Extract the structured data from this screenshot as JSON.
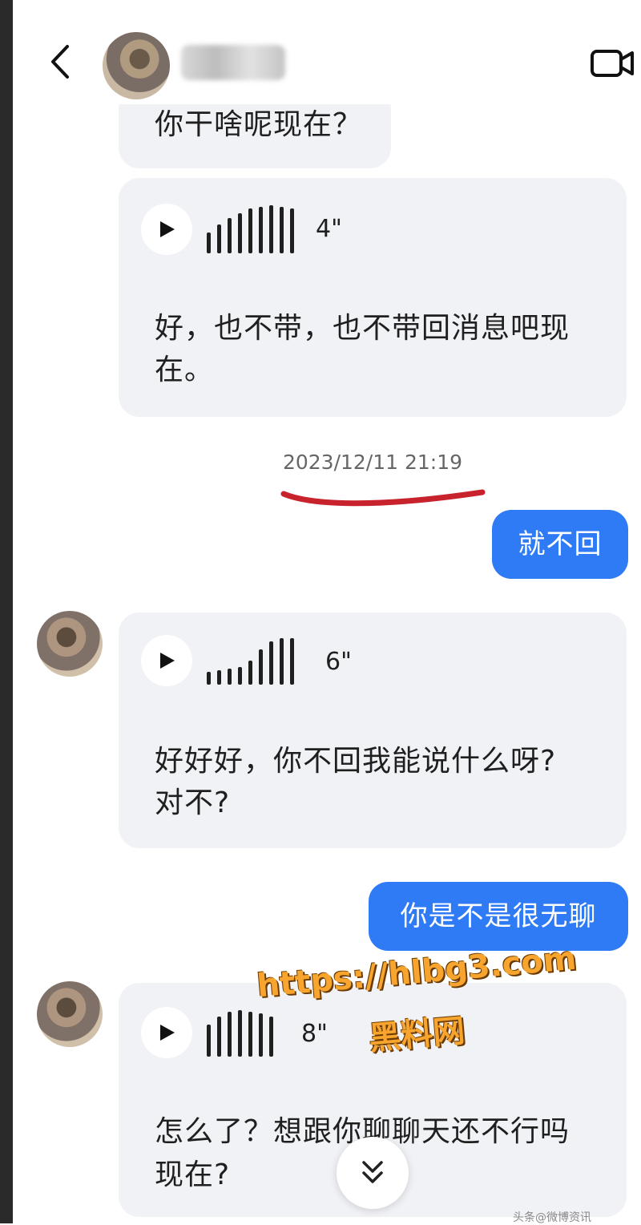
{
  "header": {
    "back_icon": "chevron-left-icon",
    "contact_name": "",
    "video_call_icon": "video-camera-icon"
  },
  "messages": {
    "m1_text": "你干啥呢现在？",
    "m2_voice_duration": "4\"",
    "m2_text_line1": "好，也不带，也不带回消息吧现",
    "m2_text_line2": "在。",
    "timestamp": "2023/12/11 21:19",
    "m3_text": "就不回",
    "m4_voice_duration": "6\"",
    "m4_text_line1": "好好好，你不回我能说什么呀?",
    "m4_text_line2": "对不?",
    "m5_text": "你是不是很无聊",
    "m6_voice_duration": "8\"",
    "m6_text_line1": "怎么了？想跟你聊聊天还不行吗",
    "m6_text_line2": "现在?"
  },
  "watermark": {
    "line1": "https://hlbg3.com",
    "line2": "黑料网"
  },
  "footer": {
    "note": "头条@微博资讯"
  },
  "colors": {
    "incoming_bubble": "#f1f2f6",
    "outgoing_bubble": "#2f7bf6",
    "annotation_underline": "#c8232c",
    "watermark": "#f7a52e"
  }
}
